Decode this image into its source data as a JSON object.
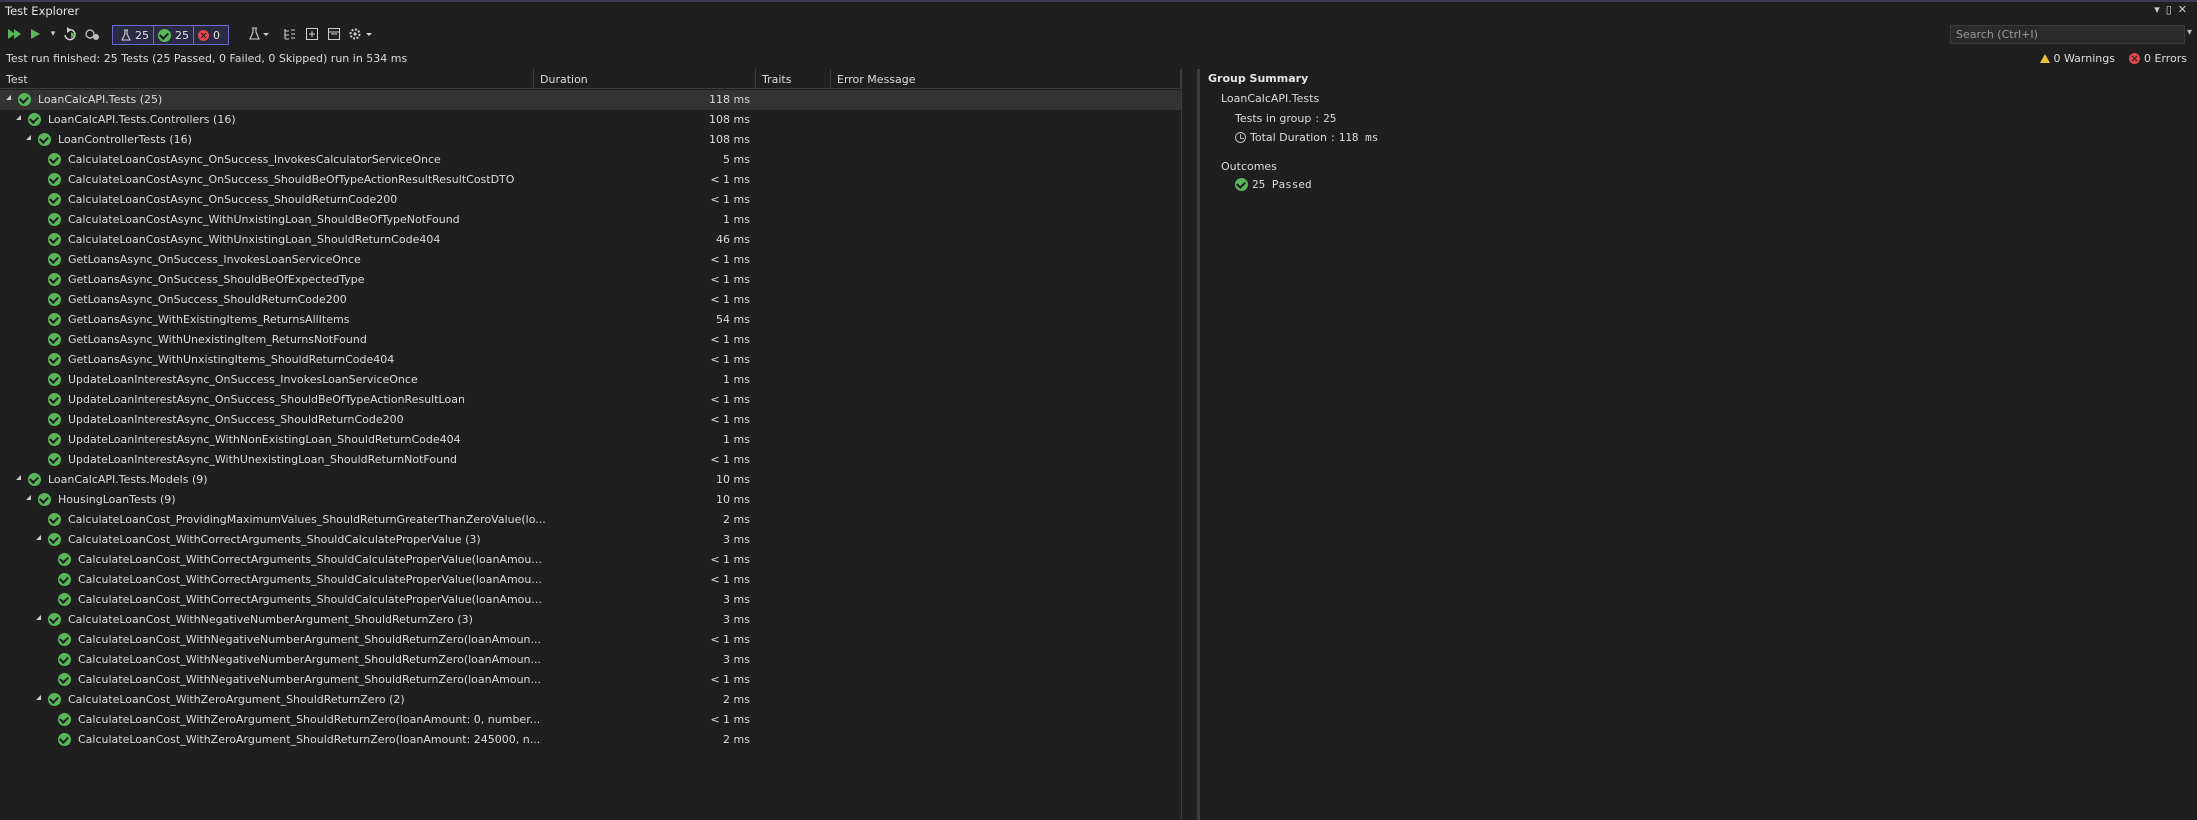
{
  "window": {
    "title": "Test Explorer"
  },
  "toolbar": {
    "total_count": "25",
    "passed_count": "25",
    "failed_count": "0",
    "search_placeholder": "Search (Ctrl+I)"
  },
  "status": {
    "summary": "Test run finished: 25 Tests (25 Passed, 0 Failed, 0 Skipped) run in 534 ms",
    "warnings": "0 Warnings",
    "errors": "0 Errors"
  },
  "columns": {
    "test": "Test",
    "duration": "Duration",
    "traits": "Traits",
    "error": "Error Message"
  },
  "rows": [
    {
      "name": "LoanCalcAPI.Tests (25)",
      "duration": "118 ms"
    },
    {
      "name": "LoanCalcAPI.Tests.Controllers (16)",
      "duration": "108 ms"
    },
    {
      "name": "LoanControllerTests (16)",
      "duration": "108 ms"
    },
    {
      "name": "CalculateLoanCostAsync_OnSuccess_InvokesCalculatorServiceOnce",
      "duration": "5 ms"
    },
    {
      "name": "CalculateLoanCostAsync_OnSuccess_ShouldBeOfTypeActionResultResultCostDTO",
      "duration": "< 1 ms"
    },
    {
      "name": "CalculateLoanCostAsync_OnSuccess_ShouldReturnCode200",
      "duration": "< 1 ms"
    },
    {
      "name": "CalculateLoanCostAsync_WithUnxistingLoan_ShouldBeOfTypeNotFound",
      "duration": "1 ms"
    },
    {
      "name": "CalculateLoanCostAsync_WithUnxistingLoan_ShouldReturnCode404",
      "duration": "46 ms"
    },
    {
      "name": "GetLoansAsync_OnSuccess_InvokesLoanServiceOnce",
      "duration": "< 1 ms"
    },
    {
      "name": "GetLoansAsync_OnSuccess_ShouldBeOfExpectedType",
      "duration": "< 1 ms"
    },
    {
      "name": "GetLoansAsync_OnSuccess_ShouldReturnCode200",
      "duration": "< 1 ms"
    },
    {
      "name": "GetLoansAsync_WithExistingItems_ReturnsAllItems",
      "duration": "54 ms"
    },
    {
      "name": "GetLoansAsync_WithUnexistingItem_ReturnsNotFound",
      "duration": "< 1 ms"
    },
    {
      "name": "GetLoansAsync_WithUnxistingItems_ShouldReturnCode404",
      "duration": "< 1 ms"
    },
    {
      "name": "UpdateLoanInterestAsync_OnSuccess_InvokesLoanServiceOnce",
      "duration": "1 ms"
    },
    {
      "name": "UpdateLoanInterestAsync_OnSuccess_ShouldBeOfTypeActionResultLoan",
      "duration": "< 1 ms"
    },
    {
      "name": "UpdateLoanInterestAsync_OnSuccess_ShouldReturnCode200",
      "duration": "< 1 ms"
    },
    {
      "name": "UpdateLoanInterestAsync_WithNonExistingLoan_ShouldReturnCode404",
      "duration": "1 ms"
    },
    {
      "name": "UpdateLoanInterestAsync_WithUnexistingLoan_ShouldReturnNotFound",
      "duration": "< 1 ms"
    },
    {
      "name": "LoanCalcAPI.Tests.Models (9)",
      "duration": "10 ms"
    },
    {
      "name": "HousingLoanTests (9)",
      "duration": "10 ms"
    },
    {
      "name": "CalculateLoanCost_ProvidingMaximumValues_ShouldReturnGreaterThanZeroValue(lo...",
      "duration": "2 ms"
    },
    {
      "name": "CalculateLoanCost_WithCorrectArguments_ShouldCalculateProperValue (3)",
      "duration": "3 ms"
    },
    {
      "name": "CalculateLoanCost_WithCorrectArguments_ShouldCalculateProperValue(loanAmou...",
      "duration": "< 1 ms"
    },
    {
      "name": "CalculateLoanCost_WithCorrectArguments_ShouldCalculateProperValue(loanAmou...",
      "duration": "< 1 ms"
    },
    {
      "name": "CalculateLoanCost_WithCorrectArguments_ShouldCalculateProperValue(loanAmou...",
      "duration": "3 ms"
    },
    {
      "name": "CalculateLoanCost_WithNegativeNumberArgument_ShouldReturnZero (3)",
      "duration": "3 ms"
    },
    {
      "name": "CalculateLoanCost_WithNegativeNumberArgument_ShouldReturnZero(loanAmoun...",
      "duration": "< 1 ms"
    },
    {
      "name": "CalculateLoanCost_WithNegativeNumberArgument_ShouldReturnZero(loanAmoun...",
      "duration": "3 ms"
    },
    {
      "name": "CalculateLoanCost_WithNegativeNumberArgument_ShouldReturnZero(loanAmoun...",
      "duration": "< 1 ms"
    },
    {
      "name": "CalculateLoanCost_WithZeroArgument_ShouldReturnZero (2)",
      "duration": "2 ms"
    },
    {
      "name": "CalculateLoanCost_WithZeroArgument_ShouldReturnZero(loanAmount: 0, number...",
      "duration": "< 1 ms"
    },
    {
      "name": "CalculateLoanCost_WithZeroArgument_ShouldReturnZero(loanAmount: 245000, n...",
      "duration": "2 ms"
    }
  ],
  "summary": {
    "heading": "Group Summary",
    "group": "LoanCalcAPI.Tests",
    "tests_label": "Tests in group",
    "tests_value": "25",
    "duration_label": "Total Duration",
    "duration_value": "118 ms",
    "outcomes_label": "Outcomes",
    "passed": "25 Passed"
  },
  "colors": {
    "pass": "#5ab65a",
    "fail": "#e04848",
    "warn": "#e8c23a",
    "accent": "#6a6acb"
  }
}
